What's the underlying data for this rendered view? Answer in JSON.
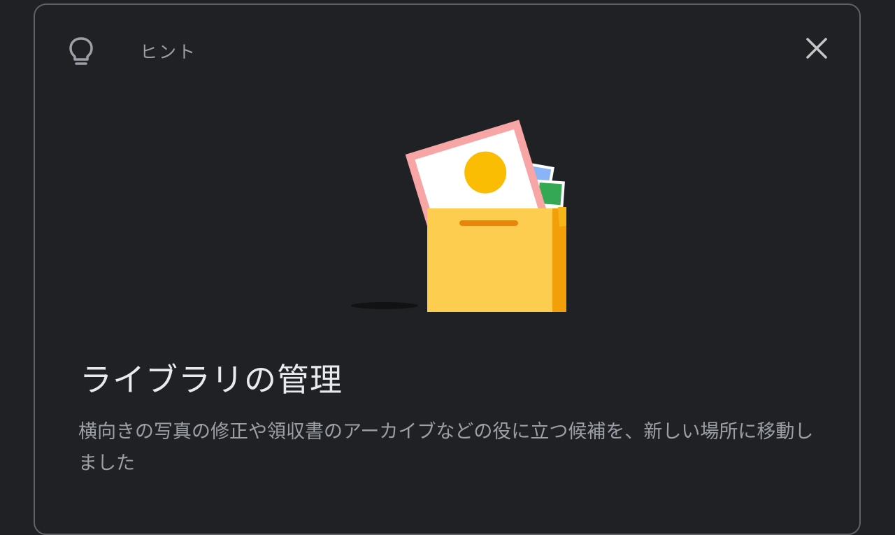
{
  "hint_card": {
    "header_label": "ヒント",
    "title": "ライブラリの管理",
    "description": "横向きの写真の修正や領収書のアーカイブなどの役に立つ候補を、新しい場所に移動しました",
    "icons": {
      "header": "lightbulb-icon",
      "close": "close-icon",
      "illustration": "photo-box-illustration"
    },
    "colors": {
      "background": "#202124",
      "border": "#5f6368",
      "title_text": "#e8eaed",
      "secondary_text": "#9aa0a6",
      "box_front": "#fdcd4f",
      "box_side": "#f29f0a",
      "photo_frame": "#f8a5a5",
      "sun": "#fbbc04"
    }
  }
}
